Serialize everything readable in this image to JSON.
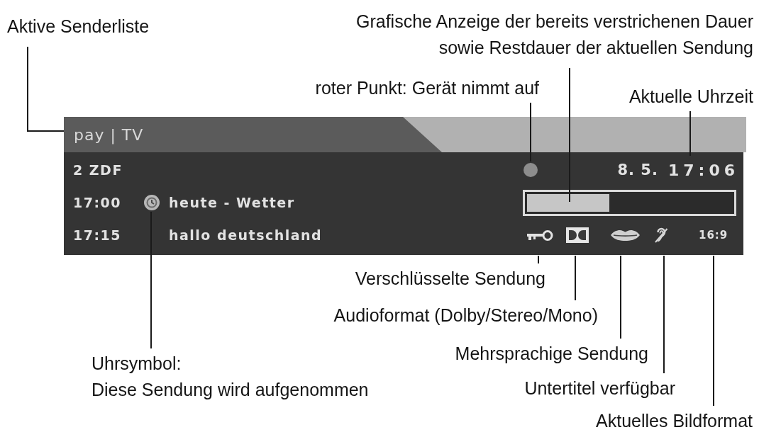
{
  "callouts_above": [
    {
      "lines": [
        "Aktive Senderliste"
      ]
    },
    {
      "lines": [
        "Grafische Anzeige der bereits verstrichenen Dauer",
        "sowie Restdauer der aktuellen Sendung"
      ]
    },
    {
      "lines": [
        "roter Punkt: Gerät nimmt auf"
      ]
    },
    {
      "lines": [
        "Aktuelle Uhrzeit"
      ]
    }
  ],
  "info_bar": {
    "list_name": "pay | TV",
    "channel": "2 ZDF",
    "recording": true,
    "date": "8. 5.",
    "time": "17:06",
    "programs": [
      {
        "time": "17:00",
        "title": "heute - Wetter",
        "timer": true
      },
      {
        "time": "17:15",
        "title": "hallo deutschland",
        "timer": false
      }
    ],
    "progress": {
      "level": 0.4
    },
    "encrypted": true,
    "dolby_audio": true,
    "multilingual": true,
    "subtitles": true,
    "aspect_ratio": "16:9"
  },
  "callouts_below": [
    {
      "lines": [
        "Verschlüsselte Sendung"
      ]
    },
    {
      "lines": [
        "Audioformat (Dolby/Stereo/Mono)"
      ]
    },
    {
      "lines": [
        "Uhrsymbol:",
        "Diese Sendung wird aufgenommen"
      ]
    },
    {
      "lines": [
        "Mehrsprachige Sendung"
      ]
    },
    {
      "lines": [
        "Untertitel verfügbar"
      ]
    },
    {
      "lines": [
        "Aktuelles Bildformat"
      ]
    }
  ]
}
